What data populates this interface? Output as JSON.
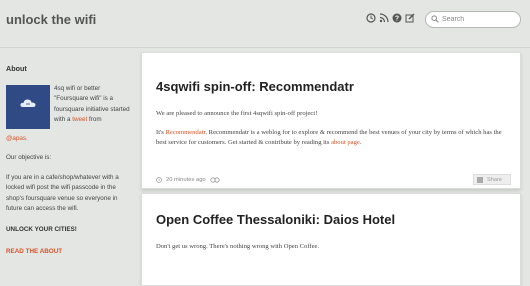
{
  "header": {
    "logo": "unlock the wifi",
    "search_placeholder": "Search",
    "icons": [
      "history-icon",
      "rss-icon",
      "help-icon",
      "edit-icon"
    ]
  },
  "sidebar": {
    "title": "About",
    "about_text": "4sq wifi or better \"Foursquare wifi\" is a foursquare initiative started with a",
    "tweet_link": "tweet",
    "about_from": "from",
    "apas": "@apas.",
    "objective_heading": "Our objective is:",
    "objective_text": "If you are in a cafe/shop/whatever with a locked wifi post the wifi passcode in the shop's foursquare venue so everyone in future can access the wifi.",
    "unlock": "UNLOCK YOUR CITIES!",
    "read_about": "READ THE ABOUT"
  },
  "posts": [
    {
      "title": "4sqwifi spin-off: Recommendatr",
      "p1": "We are pleased to announce the first 4sqwifi spin-off project!",
      "p2_pre": "It's",
      "p2_link": "Recommendatr",
      "p2_mid": ". Recommendatr is a weblog for to explore & recommend the best venues of your city by terms of which has the best service for customers. Get started & contribute by reading its",
      "p2_link2": "about page",
      "p2_end": ".",
      "time": "20 minutes ago",
      "share": "Share"
    },
    {
      "title": "Open Coffee Thessaloniki: Daios Hotel",
      "p1": "Don't get us wrong. There's nothing wrong with Open Coffee."
    }
  ],
  "colors": {
    "accent": "#d9542a",
    "background": "#e3e6e3",
    "avatar": "#2f4a84"
  }
}
